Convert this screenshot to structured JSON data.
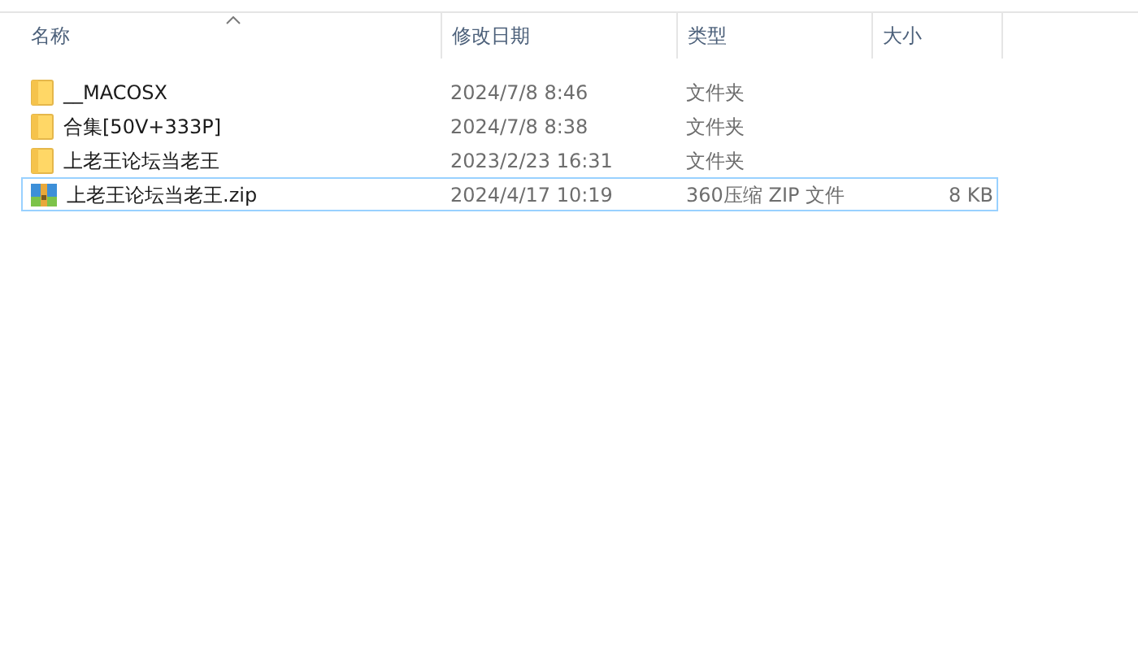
{
  "columns": [
    {
      "label": "名称",
      "sorted": true
    },
    {
      "label": "修改日期",
      "sorted": false
    },
    {
      "label": "类型",
      "sorted": false
    },
    {
      "label": "大小",
      "sorted": false
    }
  ],
  "files": [
    {
      "kind": "folder",
      "name": "__MACOSX",
      "date": "2024/7/8 8:46",
      "type": "文件夹",
      "focused": false
    },
    {
      "kind": "folder",
      "name": "合集[50V+333P]",
      "date": "2024/7/8 8:38",
      "type": "文件夹",
      "focused": false
    },
    {
      "kind": "folder",
      "name": "上老王论坛当老王",
      "date": "2023/2/23 16:31",
      "type": "文件夹",
      "focused": false
    },
    {
      "kind": "zip",
      "name": "上老王论坛当老王.zip",
      "date": "2024/4/17 10:19",
      "type": "360压缩 ZIP 文件",
      "size": "8 KB",
      "focused": true
    }
  ]
}
